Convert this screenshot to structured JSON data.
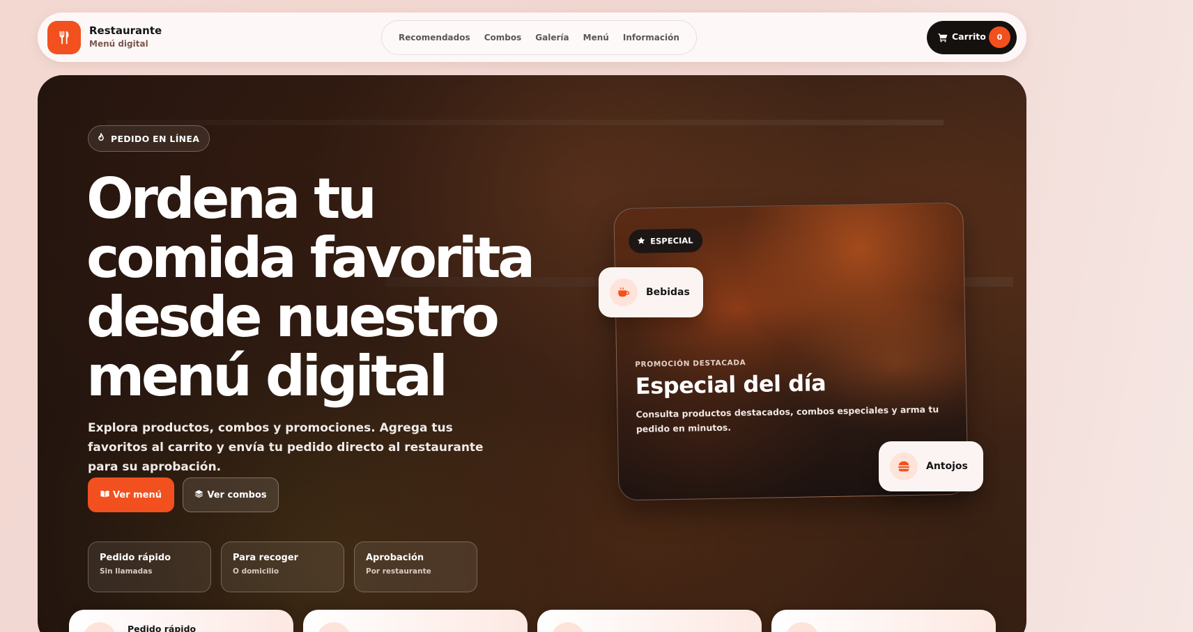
{
  "brand": {
    "name": "Restaurante",
    "subtitle": "Menú digital",
    "logo_icon": "utensils-icon",
    "accent": "#f2501e"
  },
  "nav": {
    "items": [
      "Recomendados",
      "Combos",
      "Galería",
      "Menú",
      "Información"
    ]
  },
  "cart": {
    "label": "Carrito",
    "count": "0",
    "icon": "cart-icon"
  },
  "hero": {
    "badge": "PEDIDO EN LÍNEA",
    "badge_icon": "fire-icon",
    "title": "Ordena tu comida favorita desde nuestro menú digital",
    "description": "Explora productos, combos y promociones. Agrega tus favoritos al carrito y envía tu pedido directo al restaurante para su aprobación.",
    "buttons": {
      "menu": "Ver menú",
      "combos": "Ver combos"
    },
    "features": [
      {
        "title": "Pedido rápido",
        "subtitle": "Sin llamadas"
      },
      {
        "title": "Para recoger",
        "subtitle": "O domicilio"
      },
      {
        "title": "Aprobación",
        "subtitle": "Por restaurante"
      }
    ]
  },
  "special_card": {
    "badge": "ESPECIAL",
    "badge_icon": "star-icon",
    "kicker": "PROMOCIÓN DESTACADA",
    "title": "Especial del día",
    "description": "Consulta productos destacados, combos especiales y arma tu pedido en minutos.",
    "chips": [
      {
        "label": "Bebidas",
        "icon": "coffee-icon"
      },
      {
        "label": "Antojos",
        "icon": "burger-icon"
      }
    ]
  },
  "steps": [
    {
      "title": "Pedido rápido"
    }
  ]
}
